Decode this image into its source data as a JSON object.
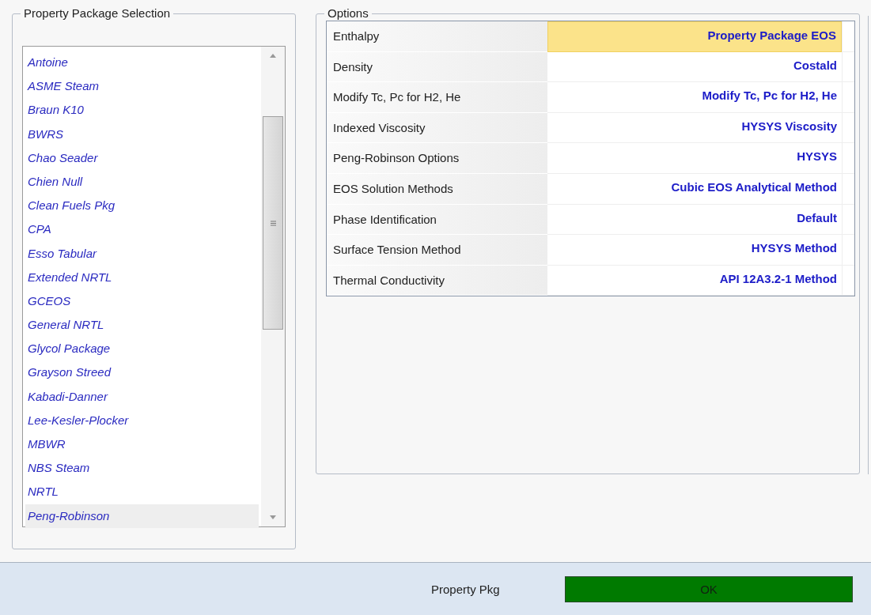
{
  "property_package_selection": {
    "title": "Property Package Selection",
    "items": [
      {
        "label": "Antoine",
        "selected": false
      },
      {
        "label": "ASME Steam",
        "selected": false
      },
      {
        "label": "Braun K10",
        "selected": false
      },
      {
        "label": "BWRS",
        "selected": false
      },
      {
        "label": "Chao Seader",
        "selected": false
      },
      {
        "label": "Chien Null",
        "selected": false
      },
      {
        "label": "Clean Fuels Pkg",
        "selected": false
      },
      {
        "label": "CPA",
        "selected": false
      },
      {
        "label": "Esso Tabular",
        "selected": false
      },
      {
        "label": "Extended NRTL",
        "selected": false
      },
      {
        "label": "GCEOS",
        "selected": false
      },
      {
        "label": "General NRTL",
        "selected": false
      },
      {
        "label": "Glycol Package",
        "selected": false
      },
      {
        "label": "Grayson Streed",
        "selected": false
      },
      {
        "label": "Kabadi-Danner",
        "selected": false
      },
      {
        "label": "Lee-Kesler-Plocker",
        "selected": false
      },
      {
        "label": "MBWR",
        "selected": false
      },
      {
        "label": "NBS Steam",
        "selected": false
      },
      {
        "label": "NRTL",
        "selected": false
      },
      {
        "label": "Peng-Robinson",
        "selected": true
      }
    ]
  },
  "options": {
    "title": "Options",
    "rows": [
      {
        "name": "Enthalpy",
        "value": "Property Package EOS",
        "selected": true
      },
      {
        "name": "Density",
        "value": "Costald",
        "selected": false
      },
      {
        "name": "Modify Tc, Pc for H2, He",
        "value": "Modify Tc, Pc for H2, He",
        "selected": false
      },
      {
        "name": "Indexed Viscosity",
        "value": "HYSYS Viscosity",
        "selected": false
      },
      {
        "name": "Peng-Robinson Options",
        "value": "HYSYS",
        "selected": false
      },
      {
        "name": "EOS Solution Methods",
        "value": "Cubic EOS Analytical Method",
        "selected": false
      },
      {
        "name": "Phase Identification",
        "value": "Default",
        "selected": false
      },
      {
        "name": "Surface Tension Method",
        "value": "HYSYS Method",
        "selected": false
      },
      {
        "name": "Thermal Conductivity",
        "value": "API 12A3.2-1 Method",
        "selected": false
      }
    ]
  },
  "status_bar": {
    "label": "Property Pkg",
    "status": "OK"
  }
}
